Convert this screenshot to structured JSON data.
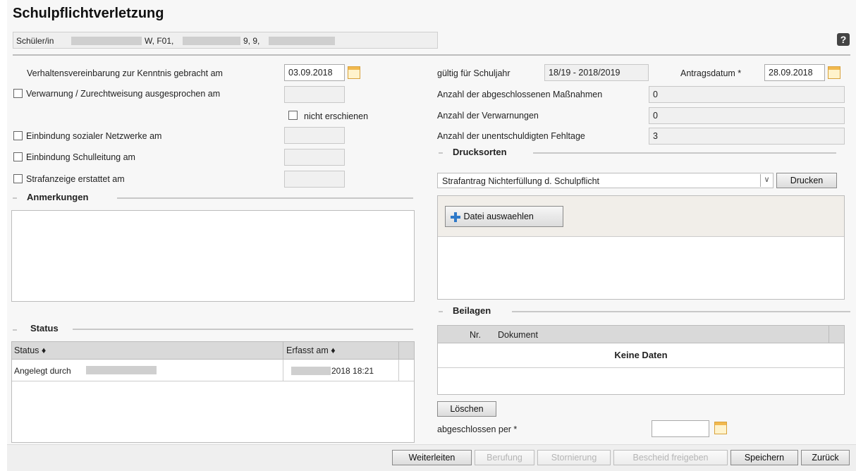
{
  "header": {
    "title": "Schulpflichtverletzung",
    "help_icon": "?"
  },
  "student": {
    "label": "Schüler/in",
    "part1": "W, F01,",
    "part2": "9, 9,"
  },
  "left": {
    "rows": [
      {
        "label": "Verhaltensvereinbarung zur Kenntnis gebracht am",
        "value": "03.09.2018",
        "checkbox": false
      },
      {
        "label": "Verwarnung / Zurechtweisung ausgesprochen am",
        "value": "",
        "checkbox": true
      },
      {
        "label": "Einbindung sozialer Netzwerke am",
        "value": "",
        "checkbox": true
      },
      {
        "label": "Einbindung Schulleitung am",
        "value": "",
        "checkbox": true
      },
      {
        "label": "Strafanzeige erstattet am",
        "value": "",
        "checkbox": true
      }
    ],
    "nicht_erschienen": "nicht erschienen",
    "anmerkungen_title": "Anmerkungen",
    "status_title": "Status",
    "status_table": {
      "headers": [
        "Status ♦",
        "Erfasst am ♦"
      ],
      "rows": [
        {
          "status": "Angelegt durch",
          "erfasst": "2018 18:21"
        }
      ]
    }
  },
  "right": {
    "schuljahr_label": "gültig für Schuljahr",
    "schuljahr_value": "18/19 - 2018/2019",
    "antrag_label": "Antragsdatum *",
    "antrag_value": "28.09.2018",
    "counts": [
      {
        "label": "Anzahl der abgeschlossenen Maßnahmen",
        "value": "0"
      },
      {
        "label": "Anzahl der Verwarnungen",
        "value": "0"
      },
      {
        "label": "Anzahl der unentschuldigten Fehltage",
        "value": "3"
      }
    ],
    "drucksorten_title": "Drucksorten",
    "drucksorte_selected": "Strafantrag Nichterfüllung d. Schulpflicht",
    "drucken_label": "Drucken",
    "datei_label": "Datei auswaehlen",
    "beilagen_title": "Beilagen",
    "beilagen_headers": [
      "Nr.",
      "Dokument"
    ],
    "beilagen_empty": "Keine Daten",
    "loeschen_label": "Löschen",
    "abgeschlossen_label": "abgeschlossen per *",
    "abgeschlossen_value": ""
  },
  "footer": {
    "buttons": [
      {
        "label": "Weiterleiten",
        "enabled": true
      },
      {
        "label": "Berufung",
        "enabled": false
      },
      {
        "label": "Stornierung",
        "enabled": false
      },
      {
        "label": "Bescheid freigeben",
        "enabled": false
      },
      {
        "label": "Speichern",
        "enabled": true
      },
      {
        "label": "Zurück",
        "enabled": true
      }
    ]
  }
}
